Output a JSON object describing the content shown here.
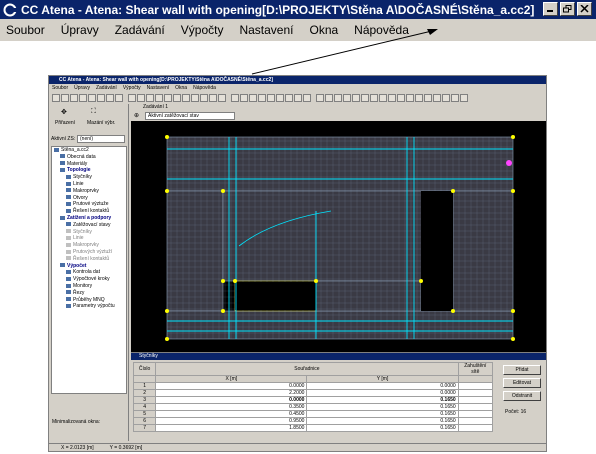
{
  "big": {
    "title": "CC Atena - Atena: Shear wall with opening[D:\\PROJEKTY\\Stěna A\\DOČASNÉ\\Stěna_a.cc2]",
    "menu": [
      {
        "label": "Soubor"
      },
      {
        "label": "Úpravy"
      },
      {
        "label": "Zadávání"
      },
      {
        "label": "Výpočty"
      },
      {
        "label": "Nastavení"
      },
      {
        "label": "Okna"
      },
      {
        "label": "Nápověda"
      }
    ]
  },
  "shot": {
    "title": "CC Atena - Atena: Shear wall with opening[D:\\PROJEKTY\\Stěna A\\DOČASNÉ\\Stěna_a.cc2]",
    "menu": [
      "Soubor",
      "Úpravy",
      "Zadávání",
      "Výpočty",
      "Nastavení",
      "Okna",
      "Nápověda"
    ],
    "left": {
      "btn1": "Přiřazení",
      "btn2": "Mazání výbr.",
      "aktivni_label": "Aktivní ZS:",
      "aktivni_value": "(není)",
      "tree": [
        {
          "label": "Stěna_a.cc2",
          "icon": "file-icon",
          "color": "#000000",
          "indent": 0
        },
        {
          "label": "Obecná data",
          "icon": "data-icon",
          "color": "#000000",
          "indent": 1
        },
        {
          "label": "Materiály",
          "icon": "material-icon",
          "color": "#000000",
          "indent": 1
        },
        {
          "label": "Topologie",
          "icon": "topology-icon",
          "color": "#000080",
          "indent": 1
        },
        {
          "label": "Styčníky",
          "icon": "node-icon",
          "color": "#000000",
          "indent": 2,
          "selected": true
        },
        {
          "label": "Linie",
          "icon": "line-icon",
          "color": "#000000",
          "indent": 2
        },
        {
          "label": "Makroprvky",
          "icon": "macro-icon",
          "color": "#000000",
          "indent": 2
        },
        {
          "label": "Otvory",
          "icon": "opening-icon",
          "color": "#000000",
          "indent": 2
        },
        {
          "label": "Prutové výztuže",
          "icon": "rebar-icon",
          "color": "#000000",
          "indent": 2
        },
        {
          "label": "Řešení kontaktů",
          "icon": "contact-icon",
          "color": "#000000",
          "indent": 2
        },
        {
          "label": "Zatížení a podpory",
          "icon": "load-icon",
          "color": "#000080",
          "indent": 1
        },
        {
          "label": "Zatěžovací stavy",
          "icon": "loadcase-icon",
          "color": "#000000",
          "indent": 2
        },
        {
          "label": "Styčníky",
          "icon": "node-icon",
          "color": "#808080",
          "indent": 2
        },
        {
          "label": "Linie",
          "icon": "line-icon",
          "color": "#808080",
          "indent": 2
        },
        {
          "label": "Makroprvky",
          "icon": "macro-icon",
          "color": "#808080",
          "indent": 2
        },
        {
          "label": "Prutových výztuží",
          "icon": "rebar-icon",
          "color": "#808080",
          "indent": 2
        },
        {
          "label": "Řešení kontaktů",
          "icon": "contact-icon",
          "color": "#808080",
          "indent": 2
        },
        {
          "label": "Výpočet",
          "icon": "calc-icon",
          "color": "#000080",
          "indent": 1
        },
        {
          "label": "Kontrola dat",
          "icon": "check-icon",
          "color": "#000000",
          "indent": 2
        },
        {
          "label": "Výpočtové kroky",
          "icon": "steps-icon",
          "color": "#000000",
          "indent": 2
        },
        {
          "label": "Monitory",
          "icon": "monitor-icon",
          "color": "#000000",
          "indent": 2
        },
        {
          "label": "Řezy",
          "icon": "cut-icon",
          "color": "#000000",
          "indent": 2
        },
        {
          "label": "Průběhy MNQ",
          "icon": "mnq-icon",
          "color": "#000000",
          "indent": 2
        },
        {
          "label": "Parametry výpočtu",
          "icon": "params-icon",
          "color": "#000000",
          "indent": 2
        }
      ],
      "minim": "Minimalizovaná okna:"
    },
    "status": {
      "x": "X = 2.0123 [m]",
      "y": "Y = 0.3692 [m]"
    },
    "canvas_tab": "Zadávání 1",
    "combo": "Aktivní zatěžovací stav",
    "grid": {
      "title": "Styčníky",
      "col_cislo": "Číslo",
      "col_souradnice": "Souřadnice",
      "col_x": "X [m]",
      "col_y": "Y [m]",
      "col_zah": "Zahuštění sítě",
      "rows": [
        {
          "n": "1",
          "x": "0.0000",
          "y": "0.0000"
        },
        {
          "n": "2",
          "x": "2.2000",
          "y": "0.0000"
        },
        {
          "n": "3",
          "x": "0.0000",
          "y": "0.1650",
          "sel": true
        },
        {
          "n": "4",
          "x": "0.3500",
          "y": "0.1650"
        },
        {
          "n": "5",
          "x": "0.4500",
          "y": "0.1650"
        },
        {
          "n": "6",
          "x": "0.9500",
          "y": "0.1650"
        },
        {
          "n": "7",
          "x": "1.8500",
          "y": "0.1650"
        }
      ],
      "btn_add": "Přidat",
      "btn_edit": "Editovat",
      "btn_del": "Odstranit",
      "count": "Počet: 16"
    }
  },
  "colors": {
    "titlebar": "#0a246a",
    "face": "#d4d0c8",
    "mesh": "#8aa0b8",
    "rebar": "#00e5ff",
    "node": "#ffff00",
    "selected_node": "#ff44ff"
  }
}
